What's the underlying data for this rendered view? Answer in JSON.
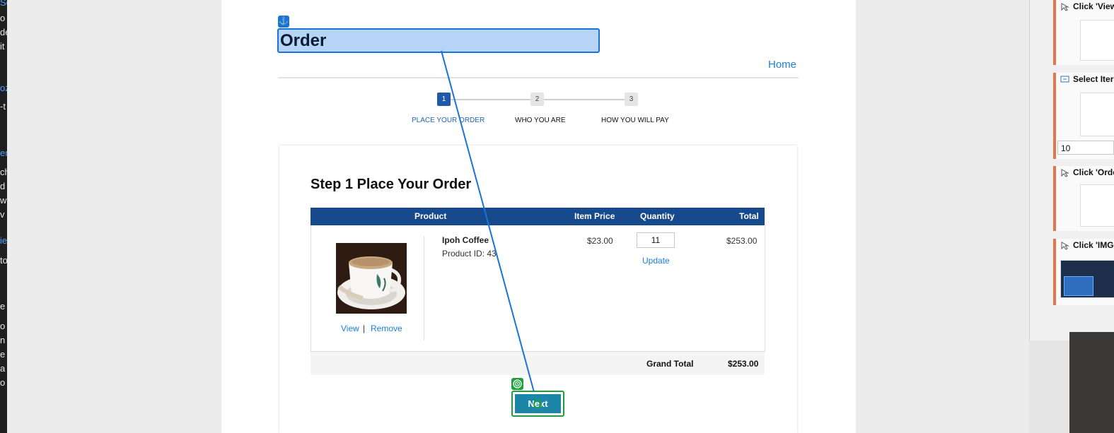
{
  "left_strip": {
    "lines": [
      "So",
      "o",
      "de",
      "it",
      "oz",
      "-t",
      "ery",
      "ch",
      "d",
      "w",
      "v",
      "ie",
      "to",
      "e t",
      "o",
      "n",
      "e",
      "a",
      "o"
    ]
  },
  "header": {
    "anchor_icon": "anchor-icon",
    "title": "Order",
    "home_link": "Home"
  },
  "stepper": {
    "steps": [
      {
        "number": "1",
        "label": "PLACE YOUR ORDER",
        "active": true
      },
      {
        "number": "2",
        "label": "WHO YOU ARE",
        "active": false
      },
      {
        "number": "3",
        "label": "HOW YOU WILL PAY",
        "active": false
      }
    ]
  },
  "order": {
    "heading": "Step 1 Place Your Order",
    "columns": {
      "product": "Product",
      "item_price": "Item Price",
      "quantity": "Quantity",
      "total": "Total"
    },
    "item": {
      "name": "Ipoh Coffee",
      "product_id": "Product ID: 43",
      "price": "$23.00",
      "quantity": "11",
      "update_label": "Update",
      "total": "$253.00",
      "view_label": "View",
      "separator": "|",
      "remove_label": "Remove"
    },
    "grand_total_label": "Grand Total",
    "grand_total_value": "$253.00"
  },
  "next_button": {
    "label": "Next",
    "target_icon": "target-icon"
  },
  "right_panel": {
    "cards": [
      {
        "title": "Click 'View"
      },
      {
        "title": "Select Iter"
      },
      {
        "title": "Click 'Orde"
      },
      {
        "title": "Click 'IMG"
      }
    ],
    "input_value": "10"
  },
  "colors": {
    "accent_blue": "#1a73d9",
    "table_header": "#164a8d",
    "next_button": "#1c86a8",
    "target_green": "#1aa13a",
    "card_accent": "#e8744a"
  }
}
